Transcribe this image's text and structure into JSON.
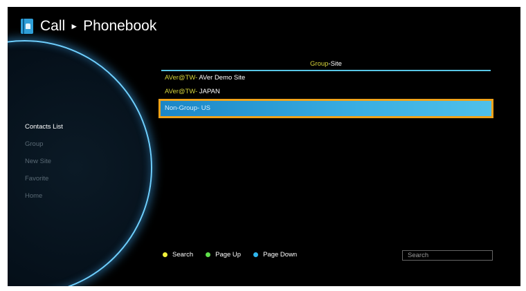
{
  "header": {
    "title": "Call",
    "separator": "►",
    "subtitle": "Phonebook",
    "icon": "phonebook-icon"
  },
  "nav": {
    "items": [
      {
        "label": "Contacts List",
        "active": true
      },
      {
        "label": "Group",
        "active": false
      },
      {
        "label": "New Site",
        "active": false
      },
      {
        "label": "Favorite",
        "active": false
      },
      {
        "label": "Home",
        "active": false
      }
    ]
  },
  "list": {
    "header_group": "Group",
    "header_rest": "-Site",
    "rows": [
      {
        "group": "AVer@TW-",
        "site": " AVer Demo Site",
        "selected": false
      },
      {
        "group": "AVer@TW-",
        "site": " JAPAN",
        "selected": false
      },
      {
        "group": "Non-Group-",
        "site": " US",
        "selected": true
      }
    ]
  },
  "footer": {
    "hints": [
      {
        "label": "Search",
        "color": "#f1f13a"
      },
      {
        "label": "Page Up",
        "color": "#5fe04a"
      },
      {
        "label": "Page Down",
        "color": "#2fb6ee"
      }
    ],
    "search_placeholder": "Search"
  },
  "colors": {
    "accent": "#d8d63a",
    "selection": "#3aaee2",
    "selection_border": "#f0a21a",
    "divider": "#59c7e6"
  }
}
